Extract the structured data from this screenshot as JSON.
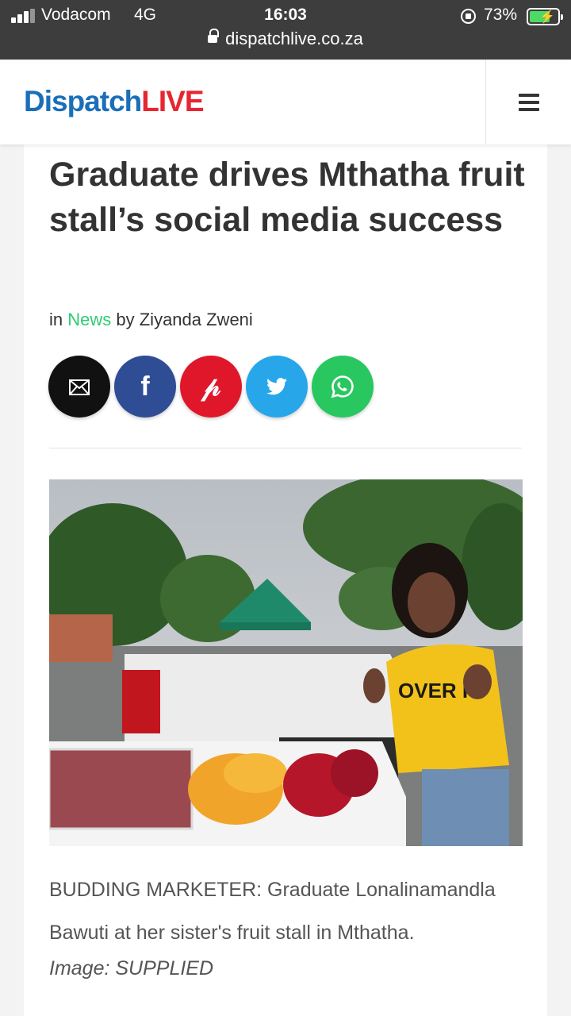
{
  "status_bar": {
    "carrier": "Vodacom",
    "network": "4G",
    "time": "16:03",
    "battery_percent": "73%",
    "battery_level": 0.73,
    "url": "dispatchlive.co.za"
  },
  "header": {
    "logo_part1": "Dispatch",
    "logo_part2": "LIVE",
    "brand_blue": "#1b6fb8",
    "brand_red": "#e62631"
  },
  "article": {
    "headline": "Graduate drives Mthatha fruit stall’s social media success",
    "byline_in": "in",
    "category": "News",
    "byline_by": "by Ziyanda Zweni",
    "share_buttons": [
      {
        "icon": "email-icon",
        "color": "#111111"
      },
      {
        "icon": "facebook-icon",
        "color": "#2f4d95"
      },
      {
        "icon": "pinterest-icon",
        "color": "#e0172b"
      },
      {
        "icon": "twitter-icon",
        "color": "#27a6ea"
      },
      {
        "icon": "whatsapp-icon",
        "color": "#28c760"
      }
    ],
    "caption": "BUDDING MARKETER: Graduate Lonalinamandla Bawuti at her sister's fruit stall in Mthatha.",
    "credit": "Image: SUPPLIED",
    "shirt_text": "OVER IT"
  }
}
